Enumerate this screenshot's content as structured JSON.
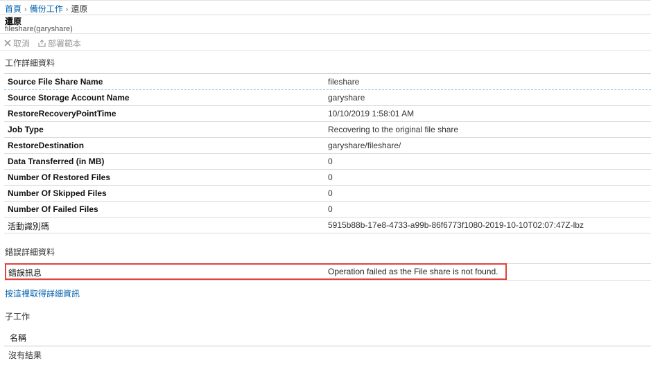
{
  "breadcrumb": {
    "items": [
      "首頁",
      "備份工作"
    ],
    "current": "還原",
    "separator": "›"
  },
  "header": {
    "title": "還原",
    "subtitle": "fileshare(garyshare)"
  },
  "toolbar": {
    "cancel_label": "取消",
    "deploy_label": "部署範本"
  },
  "job_details": {
    "title": "工作詳細資料",
    "rows": [
      {
        "key": "Source File Share Name",
        "value": "fileshare"
      },
      {
        "key": "Source Storage Account Name",
        "value": "garyshare"
      },
      {
        "key": "RestoreRecoveryPointTime",
        "value": "10/10/2019 1:58:01 AM"
      },
      {
        "key": "Job Type",
        "value": "Recovering to the original file share"
      },
      {
        "key": "RestoreDestination",
        "value": "garyshare/fileshare/"
      },
      {
        "key": "Data Transferred (in MB)",
        "value": "0"
      },
      {
        "key": "Number Of Restored Files",
        "value": "0"
      },
      {
        "key": "Number Of Skipped Files",
        "value": "0"
      },
      {
        "key": "Number Of Failed Files",
        "value": "0"
      },
      {
        "key": "活動識別碼",
        "value": "5915b88b-17e8-4733-a99b-86f6773f1080-2019-10-10T02:07:47Z-lbz"
      }
    ]
  },
  "error_details": {
    "title": "錯誤詳細資料",
    "key": "錯誤訊息",
    "value": "Operation failed as the File share is not found.",
    "more_link": "按這裡取得詳細資訊"
  },
  "sub_jobs": {
    "title": "子工作",
    "column": "名稱",
    "empty_text": "沒有結果"
  },
  "colors": {
    "link": "#0062ad",
    "highlight": "#e2423b",
    "accent_dashed": "#86c8e8"
  }
}
